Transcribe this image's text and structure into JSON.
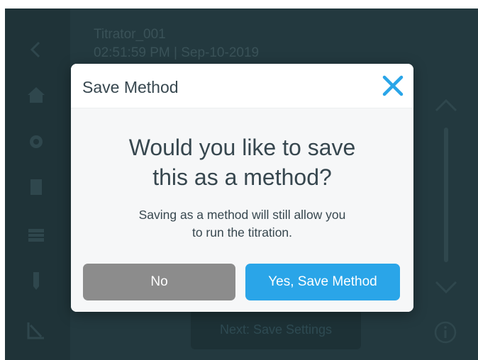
{
  "background": {
    "device_name": "Titrator_001",
    "timestamp": "02:51:59 PM | Sep-10-2019",
    "next_button_label": "Next: Save Settings"
  },
  "sidebar": {
    "items": [
      {
        "icon": "back-arrow-icon"
      },
      {
        "icon": "home-icon"
      },
      {
        "icon": "settings-icon"
      },
      {
        "icon": "document-icon"
      },
      {
        "icon": "table-icon"
      },
      {
        "icon": "probe-icon"
      },
      {
        "icon": "chart-icon"
      }
    ]
  },
  "modal": {
    "title": "Save Method",
    "close_icon": "close-icon",
    "question_line1": "Would you like to save",
    "question_line2": "this as a method?",
    "subtext_line1": "Saving as a method will still allow you",
    "subtext_line2": "to run the titration.",
    "no_label": "No",
    "yes_label": "Yes, Save Method"
  },
  "colors": {
    "screen_bg": "#23393f",
    "accent": "#2aa5e8",
    "neutral_button": "#8c8c8c",
    "close_icon": "#2aa5e8"
  }
}
